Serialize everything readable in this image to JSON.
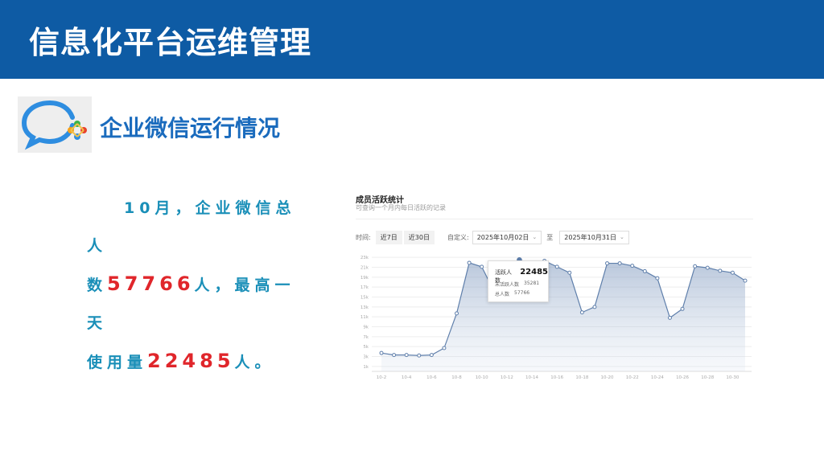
{
  "header": {
    "title": "信息化平台运维管理"
  },
  "section": {
    "title": "企业微信运行情况"
  },
  "summary": {
    "p1": "10月，企业微信总人",
    "p2a": "数",
    "total": "57766",
    "p2b": "人，最高一天",
    "p3a": "使用量",
    "peak": "22485",
    "p3b": "人。"
  },
  "chart": {
    "title": "成员活跃统计",
    "subtitle": "可查询一个月内每日活跃的记录",
    "time_label": "时间:",
    "seg_7": "近7日",
    "seg_30": "近30日",
    "custom_label": "自定义:",
    "date_from": "2025年10月02日",
    "to_label": "至",
    "date_to": "2025年10月31日",
    "tooltip": {
      "active_label": "活跃人数",
      "active_value": "22485",
      "inactive_label": "未活跃人数",
      "inactive_value": "35281",
      "total_label": "总人数",
      "total_value": "57766"
    }
  },
  "colors": {
    "header_bg": "#0e5ba4",
    "section_title": "#1a6bbd",
    "summary_text": "#1a8fb8",
    "highlight": "#e0262b",
    "series": "#5f7fab"
  },
  "icons": {
    "logo": "wecom-logo-icon"
  },
  "chart_data": {
    "type": "area",
    "title": "成员活跃统计",
    "x": [
      "10-2",
      "10-3",
      "10-4",
      "10-5",
      "10-6",
      "10-7",
      "10-8",
      "10-9",
      "10-10",
      "10-11",
      "10-12",
      "10-13",
      "10-14",
      "10-15",
      "10-16",
      "10-17",
      "10-18",
      "10-19",
      "10-20",
      "10-21",
      "10-22",
      "10-23",
      "10-24",
      "10-25",
      "10-26",
      "10-27",
      "10-28",
      "10-29",
      "10-30",
      "10-31"
    ],
    "x_tick_labels": [
      "10-2",
      "10-4",
      "10-6",
      "10-8",
      "10-10",
      "10-12",
      "10-14",
      "10-16",
      "10-18",
      "10-20",
      "10-22",
      "10-24",
      "10-26",
      "10-28",
      "10-30"
    ],
    "series": [
      {
        "name": "活跃人数",
        "values": [
          3700,
          3300,
          3300,
          3200,
          3300,
          4700,
          11700,
          21900,
          21100,
          16000,
          17500,
          22485,
          21700,
          22300,
          21100,
          19900,
          11900,
          13000,
          21800,
          21800,
          21300,
          20200,
          18800,
          10800,
          12600,
          21200,
          20900,
          20300,
          19900,
          18300
        ]
      }
    ],
    "y_ticks": [
      "1k",
      "3k",
      "5k",
      "7k",
      "9k",
      "11k",
      "13k",
      "15k",
      "17k",
      "19k",
      "21k",
      "23k"
    ],
    "ylim": [
      0,
      24000
    ],
    "grid": true
  }
}
